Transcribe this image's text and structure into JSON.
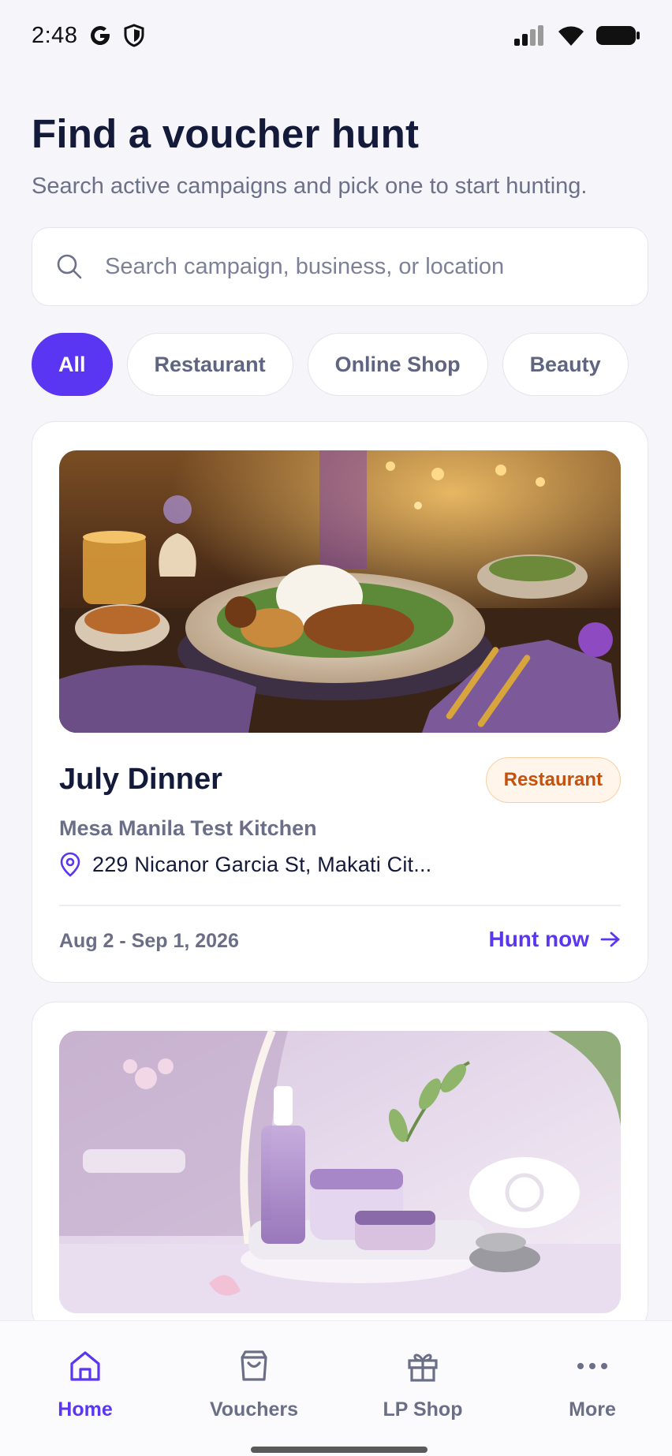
{
  "status_bar": {
    "time": "2:48"
  },
  "header": {
    "title": "Find a voucher hunt",
    "subtitle": "Search active campaigns and pick one to start hunting."
  },
  "search": {
    "placeholder": "Search campaign, business, or location",
    "value": ""
  },
  "filters": {
    "selected": "All",
    "chips": [
      {
        "label": "All"
      },
      {
        "label": "Restaurant"
      },
      {
        "label": "Online Shop"
      },
      {
        "label": "Beauty"
      }
    ]
  },
  "campaigns": [
    {
      "title": "July Dinner",
      "category": "Restaurant",
      "business": "Mesa Manila Test Kitchen",
      "location": "229 Nicanor Garcia St, Makati Cit...",
      "dates": "Aug 2 - Sep 1, 2026",
      "cta": "Hunt now",
      "image": "restaurant-dinner-photo"
    },
    {
      "image": "beauty-skincare-photo"
    }
  ],
  "colors": {
    "accent": "#5b36f2",
    "badge_text": "#c7510c",
    "badge_bg": "#fff5ea"
  },
  "nav": {
    "items": [
      {
        "label": "Home",
        "icon": "home-icon",
        "active": true
      },
      {
        "label": "Vouchers",
        "icon": "bag-icon",
        "active": false
      },
      {
        "label": "LP Shop",
        "icon": "gift-icon",
        "active": false
      },
      {
        "label": "More",
        "icon": "more-dots-icon",
        "active": false
      }
    ]
  }
}
